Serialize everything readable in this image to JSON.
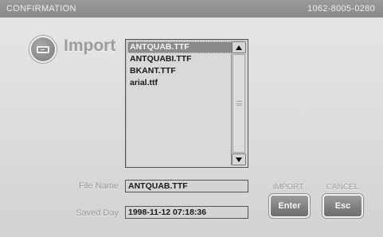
{
  "titlebar": {
    "title": "CONFIRMATION",
    "code": "1062-8005-0280"
  },
  "header": {
    "icon": "import-drive-icon",
    "label": "Import"
  },
  "filelist": {
    "items": [
      "ANTQUAB.TTF",
      "ANTQUABI.TTF",
      "BKANT.TTF",
      "arial.ttf"
    ],
    "selected": "ANTQUAB.TTF"
  },
  "fields": {
    "file_name_label": "File Name",
    "file_name_value": "ANTQUAB.TTF",
    "saved_day_label": "Saved Day",
    "saved_day_value": "1998-11-12 07:18:36"
  },
  "actions": {
    "import_caption": "IMPORT",
    "import_button": "Enter",
    "cancel_caption": "CANCEL",
    "cancel_button": "Esc"
  },
  "colors": {
    "titlebar": "#8e8e8e",
    "background": "#dcdcdc",
    "selection": "#8a8a8a",
    "button": "#7e7e7e"
  }
}
